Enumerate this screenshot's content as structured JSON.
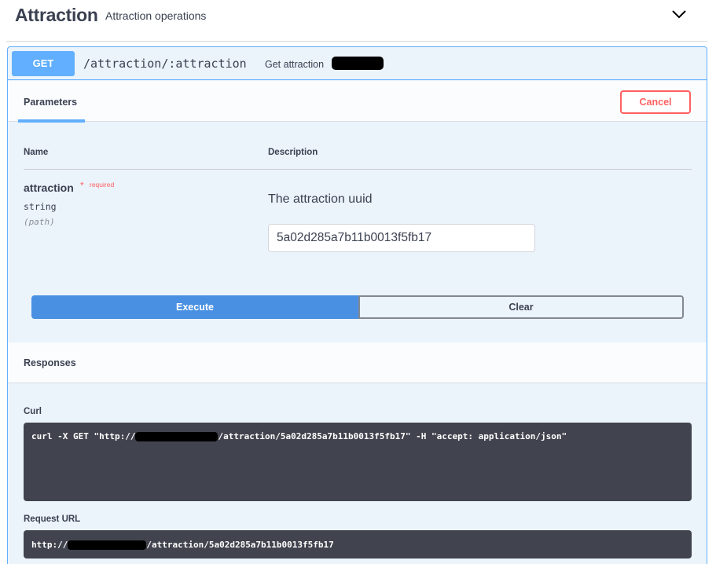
{
  "tag": {
    "title": "Attraction",
    "description": "Attraction operations",
    "toggle_icon": "chevron-down-icon"
  },
  "operation": {
    "method": "GET",
    "path": "/attraction/:attraction",
    "summary": "Get attraction"
  },
  "parameters_section": {
    "tab_label": "Parameters",
    "cancel_label": "Cancel",
    "col_name": "Name",
    "col_description": "Description"
  },
  "parameter": {
    "name": "attraction",
    "required_marker": "*",
    "required_label": "required",
    "type": "string",
    "location": "(path)",
    "description": "The attraction uuid",
    "value": "5a02d285a7b11b0013f5fb17"
  },
  "actions": {
    "execute_label": "Execute",
    "clear_label": "Clear"
  },
  "responses": {
    "header": "Responses",
    "curl_label": "Curl",
    "curl_prefix": "curl -X GET \"http://",
    "curl_suffix": "/attraction/5a02d285a7b11b0013f5fb17\" -H \"accept: application/json\"",
    "request_url_label": "Request URL",
    "request_url_prefix": "http://",
    "request_url_suffix": "/attraction/5a02d285a7b11b0013f5fb17"
  },
  "colors": {
    "get_accent": "#61affe",
    "execute_blue": "#4990e2",
    "cancel_red": "#ff6060",
    "opblock_bg": "#ebf3fb",
    "code_bg": "#41444e"
  }
}
